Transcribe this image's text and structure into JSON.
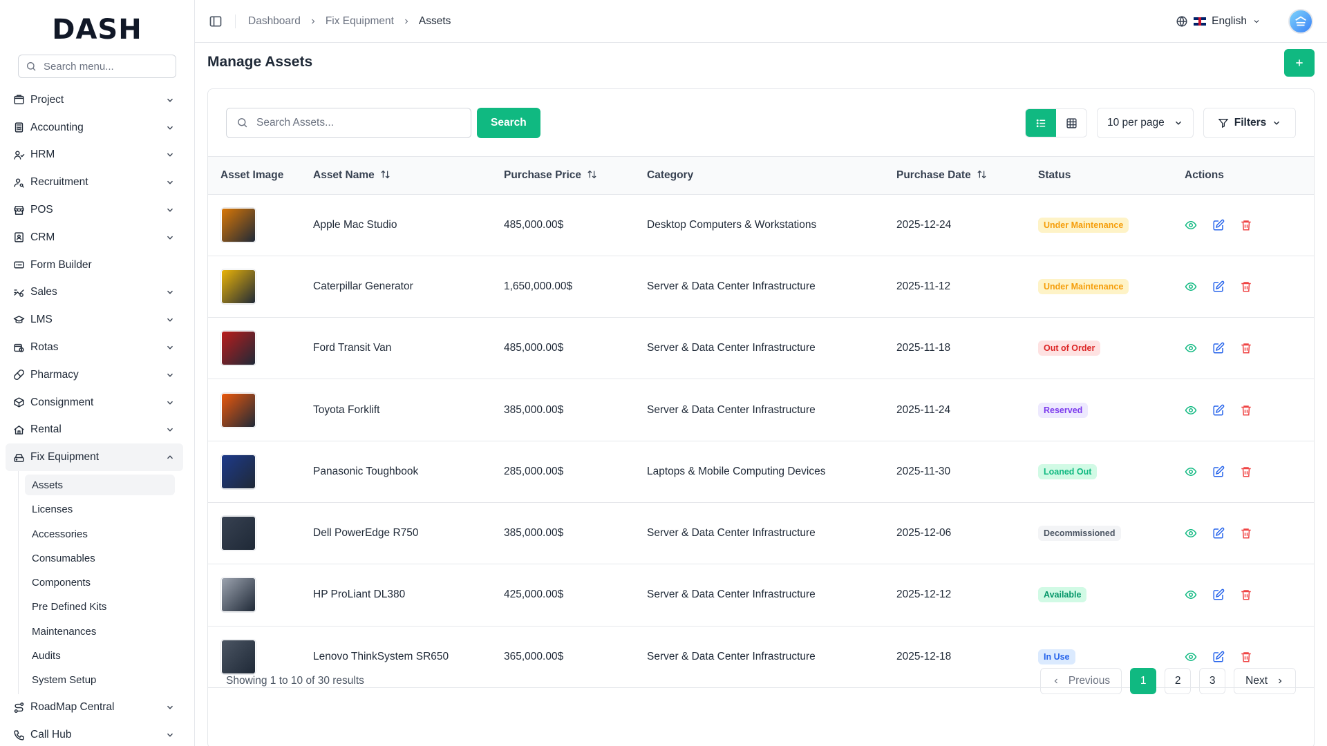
{
  "brand": {
    "logo_text": "DASH"
  },
  "sidebar": {
    "search_placeholder": "Search menu...",
    "items": [
      {
        "label": "Project",
        "icon": "project-icon",
        "expandable": true
      },
      {
        "label": "Accounting",
        "icon": "calculator-icon",
        "expandable": true
      },
      {
        "label": "HRM",
        "icon": "users-icon",
        "expandable": true
      },
      {
        "label": "Recruitment",
        "icon": "user-search-icon",
        "expandable": true
      },
      {
        "label": "POS",
        "icon": "store-icon",
        "expandable": true
      },
      {
        "label": "CRM",
        "icon": "contacts-icon",
        "expandable": true
      },
      {
        "label": "Form Builder",
        "icon": "form-icon",
        "expandable": false
      },
      {
        "label": "Sales",
        "icon": "sales-icon",
        "expandable": true
      },
      {
        "label": "LMS",
        "icon": "graduation-cap-icon",
        "expandable": true
      },
      {
        "label": "Rotas",
        "icon": "calendar-clock-icon",
        "expandable": true
      },
      {
        "label": "Pharmacy",
        "icon": "pill-icon",
        "expandable": true
      },
      {
        "label": "Consignment",
        "icon": "package-icon",
        "expandable": true
      },
      {
        "label": "Rental",
        "icon": "home-icon",
        "expandable": true
      }
    ],
    "open_item": {
      "label": "Fix Equipment",
      "icon": "hard-drive-icon",
      "sub": [
        "Assets",
        "Licenses",
        "Accessories",
        "Consumables",
        "Components",
        "Pre Defined Kits",
        "Maintenances",
        "Audits",
        "System Setup"
      ],
      "active": "Assets"
    },
    "items_after": [
      {
        "label": "RoadMap Central",
        "icon": "route-icon",
        "expandable": true
      },
      {
        "label": "Call Hub",
        "icon": "phone-icon",
        "expandable": true
      }
    ]
  },
  "topbar": {
    "breadcrumb": [
      "Dashboard",
      "Fix Equipment",
      "Assets"
    ],
    "language": "English"
  },
  "page": {
    "title": "Manage Assets"
  },
  "toolbar": {
    "search_placeholder": "Search Assets...",
    "search_label": "Search",
    "per_page": "10 per page",
    "filters_label": "Filters"
  },
  "table": {
    "headers": [
      "Asset Image",
      "Asset Name",
      "Purchase Price",
      "Category",
      "Purchase Date",
      "Status",
      "Actions"
    ],
    "rows": [
      {
        "name": "Apple Mac Studio",
        "price": "485,000.00$",
        "category": "Desktop Computers & Workstations",
        "date": "2025-12-24",
        "status": "Under Maintenance",
        "status_color": "#f59e0b",
        "status_bg": "#fef3c7",
        "thumb": "#d97706"
      },
      {
        "name": "Caterpillar Generator",
        "price": "1,650,000.00$",
        "category": "Server & Data Center Infrastructure",
        "date": "2025-11-12",
        "status": "Under Maintenance",
        "status_color": "#f59e0b",
        "status_bg": "#fef3c7",
        "thumb": "#eab308"
      },
      {
        "name": "Ford Transit Van",
        "price": "485,000.00$",
        "category": "Server & Data Center Infrastructure",
        "date": "2025-11-18",
        "status": "Out of Order",
        "status_color": "#dc2626",
        "status_bg": "#fee2e2",
        "thumb": "#b91c1c"
      },
      {
        "name": "Toyota Forklift",
        "price": "385,000.00$",
        "category": "Server & Data Center Infrastructure",
        "date": "2025-11-24",
        "status": "Reserved",
        "status_color": "#7c3aed",
        "status_bg": "#ede9fe",
        "thumb": "#ea580c"
      },
      {
        "name": "Panasonic Toughbook",
        "price": "285,000.00$",
        "category": "Laptops & Mobile Computing Devices",
        "date": "2025-11-30",
        "status": "Loaned Out",
        "status_color": "#10b981",
        "status_bg": "#d1fae5",
        "thumb": "#1e3a8a"
      },
      {
        "name": "Dell PowerEdge R750",
        "price": "385,000.00$",
        "category": "Server & Data Center Infrastructure",
        "date": "2025-12-06",
        "status": "Decommissioned",
        "status_color": "#4b5563",
        "status_bg": "#f3f4f6",
        "thumb": "#374151"
      },
      {
        "name": "HP ProLiant DL380",
        "price": "425,000.00$",
        "category": "Server & Data Center Infrastructure",
        "date": "2025-12-12",
        "status": "Available",
        "status_color": "#059669",
        "status_bg": "#d1fae5",
        "thumb": "#9ca3af"
      },
      {
        "name": "Lenovo ThinkSystem SR650",
        "price": "365,000.00$",
        "category": "Server & Data Center Infrastructure",
        "date": "2025-12-18",
        "status": "In Use",
        "status_color": "#2563eb",
        "status_bg": "#dbeafe",
        "thumb": "#4b5563"
      }
    ]
  },
  "pagination": {
    "showing": "Showing 1 to 10 of 30 results",
    "previous": "Previous",
    "pages": [
      "1",
      "2",
      "3"
    ],
    "current": "1",
    "next": "Next"
  },
  "colors": {
    "accent": "#10b981"
  }
}
